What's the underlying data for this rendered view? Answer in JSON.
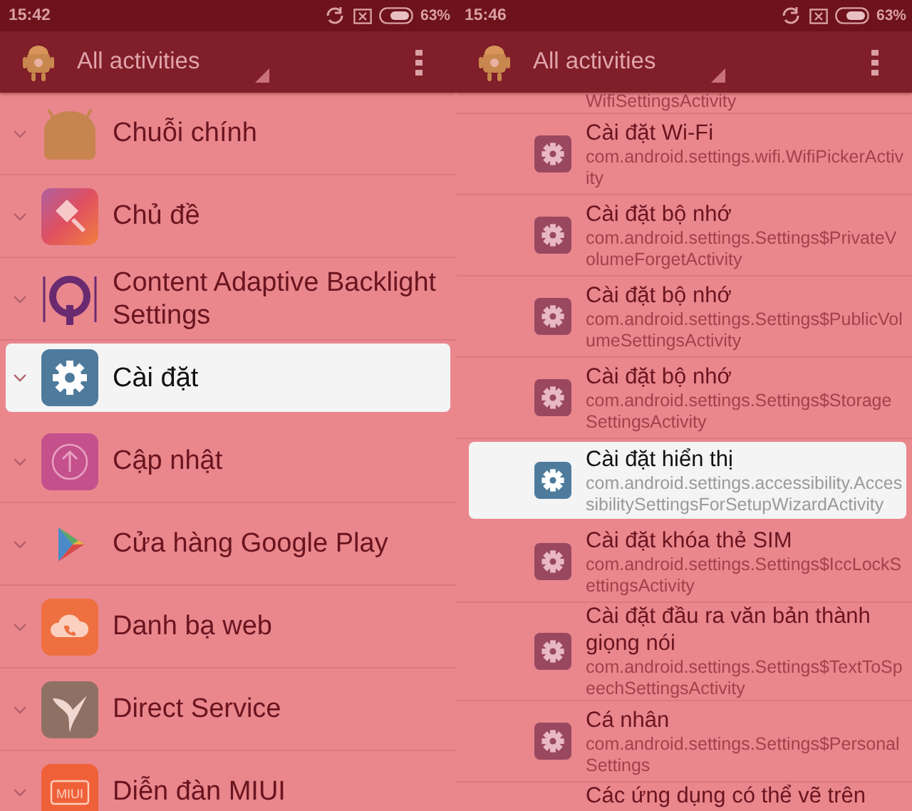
{
  "panels": [
    {
      "status_bar": {
        "time": "15:42",
        "battery": "63%"
      },
      "toolbar": {
        "title": "All activities"
      },
      "items": [
        {
          "label": "Chuỗi chính",
          "kind": "android",
          "selected": false
        },
        {
          "label": "Chủ đề",
          "kind": "theme",
          "selected": false
        },
        {
          "label": "Content Adaptive Backlight Settings",
          "kind": "q",
          "selected": false
        },
        {
          "label": "Cài đặt",
          "kind": "gear",
          "selected": true
        },
        {
          "label": "Cập nhật",
          "kind": "update",
          "selected": false
        },
        {
          "label": "Cửa hàng Google Play",
          "kind": "play",
          "selected": false
        },
        {
          "label": "Danh bạ web",
          "kind": "cloud",
          "selected": false
        },
        {
          "label": "Direct Service",
          "kind": "bird",
          "selected": false
        },
        {
          "label": "Diễn đàn MIUI",
          "kind": "miui",
          "icon_text": "MIUI",
          "selected": false
        }
      ]
    },
    {
      "status_bar": {
        "time": "15:46",
        "battery": "63%"
      },
      "toolbar": {
        "title": "All activities"
      },
      "partial_top": "WifiSettingsActivity",
      "activities": [
        {
          "label": "Cài đặt Wi-Fi",
          "activity": "com.android.settings.wifi.WifiPickerActivity",
          "selected": false
        },
        {
          "label": "Cài đặt bộ nhớ",
          "activity": "com.android.settings.Settings$PrivateVolumeForgetActivity",
          "selected": false
        },
        {
          "label": "Cài đặt bộ nhớ",
          "activity": "com.android.settings.Settings$PublicVolumeSettingsActivity",
          "selected": false
        },
        {
          "label": "Cài đặt bộ nhớ",
          "activity": "com.android.settings.Settings$StorageSettingsActivity",
          "selected": false
        },
        {
          "label": "Cài đặt hiển thị",
          "activity": "com.android.settings.accessibility.AccessibilitySettingsForSetupWizardActivity",
          "selected": true
        },
        {
          "label": "Cài đặt khóa thẻ SIM",
          "activity": "com.android.settings.Settings$IccLockSettingsActivity",
          "selected": false
        },
        {
          "label": "Cài đặt đầu ra văn bản thành giọng nói",
          "activity": "com.android.settings.Settings$TextToSpeechSettingsActivity",
          "selected": false
        },
        {
          "label": "Cá nhân",
          "activity": "com.android.settings.Settings$PersonalSettings",
          "selected": false
        }
      ],
      "partial_bottom": "Các ứng dụng có thể vẽ trên"
    }
  ]
}
